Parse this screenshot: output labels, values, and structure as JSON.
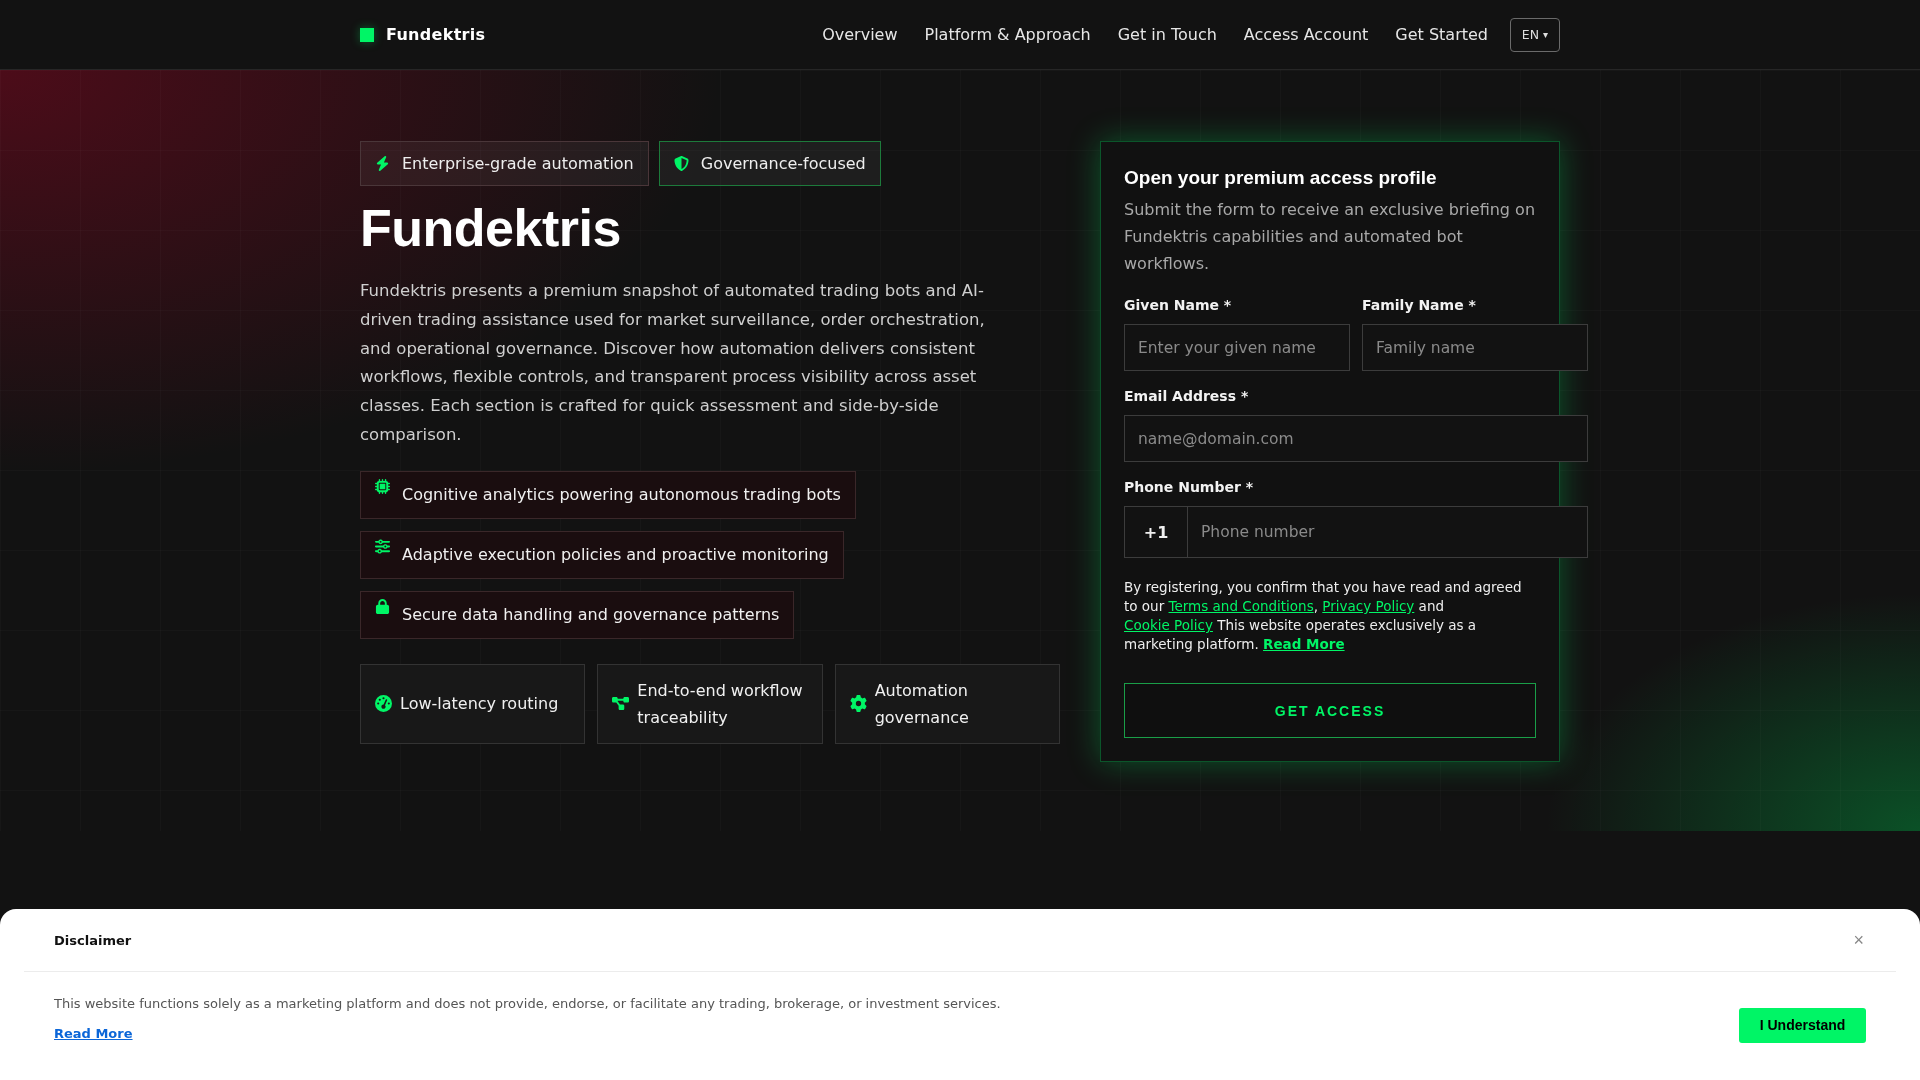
{
  "header": {
    "logo": "Fundektris",
    "nav": [
      "Overview",
      "Platform & Approach",
      "Get in Touch",
      "Access Account",
      "Get Started"
    ],
    "language": {
      "label": "EN",
      "caret": "▾"
    }
  },
  "hero": {
    "badges": [
      {
        "kind": "plain",
        "label": "Enterprise-grade automation"
      },
      {
        "kind": "accent",
        "label": "Governance-focused"
      }
    ],
    "title": "Fundektris",
    "description": "Fundektris presents a premium snapshot of automated trading bots and AI-driven trading assistance used for market surveillance, order orchestration, and operational governance. Discover how automation delivers consistent workflows, flexible controls, and transparent process visibility across asset classes. Each section is crafted for quick assessment and side-by-side comparison.",
    "highlights": [
      "Cognitive analytics powering autonomous trading bots",
      "Adaptive execution policies and proactive monitoring",
      "Secure data handling and governance patterns"
    ],
    "cards": [
      "Low-latency routing",
      "End-to-end workflow traceability",
      "Automation governance"
    ]
  },
  "form": {
    "title": "Open your premium access profile",
    "description": "Submit the form to receive an exclusive briefing on Fundektris capabilities and automated bot workflows.",
    "given_name": {
      "label": "Given Name *",
      "placeholder": "Enter your given name"
    },
    "family_name": {
      "label": "Family Name *",
      "placeholder": "Family name"
    },
    "email": {
      "label": "Email Address *",
      "placeholder": "name@domain.com"
    },
    "phone": {
      "label": "Phone Number *",
      "prefix": "+1",
      "placeholder": "Phone number"
    },
    "consent": [
      {
        "kind": "text",
        "text": "By registering, you confirm that you have read and agreed to our "
      },
      {
        "kind": "link",
        "text": "Terms and Conditions"
      },
      {
        "kind": "text",
        "text": ", "
      },
      {
        "kind": "link",
        "text": "Privacy Policy"
      },
      {
        "kind": "text",
        "text": " and "
      },
      {
        "kind": "link",
        "text": "Cookie Policy"
      },
      {
        "kind": "text",
        "text": " This website operates exclusively as a marketing platform. "
      },
      {
        "kind": "strong_link",
        "text": "Read More"
      }
    ],
    "submit": "GET ACCESS"
  },
  "disclaimer": {
    "title": "Disclaimer",
    "close": "×",
    "text": "This website functions solely as a marketing platform and does not provide, endorse, or facilitate any trading, brokerage, or investment services.",
    "read_more": "Read More",
    "button": "I Understand"
  }
}
